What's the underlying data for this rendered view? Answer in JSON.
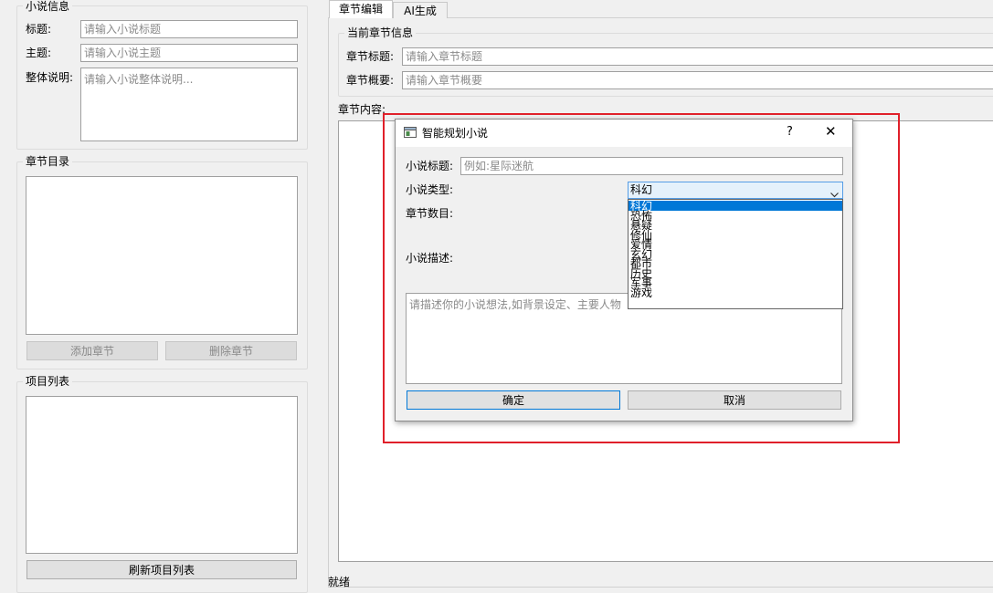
{
  "novel_info": {
    "group_title": "小说信息",
    "title_label": "标题:",
    "title_placeholder": "请输入小说标题",
    "theme_label": "主题:",
    "theme_placeholder": "请输入小说主题",
    "desc_label": "整体说明:",
    "desc_placeholder": "请输入小说整体说明..."
  },
  "chapter_toc": {
    "group_title": "章节目录",
    "add_button": "添加章节",
    "delete_button": "删除章节"
  },
  "project_list": {
    "group_title": "项目列表",
    "refresh_button": "刷新项目列表"
  },
  "tabs": [
    {
      "label": "章节编辑",
      "active": true
    },
    {
      "label": "AI生成",
      "active": false
    }
  ],
  "current_chapter": {
    "group_title": "当前章节信息",
    "title_label": "章节标题:",
    "title_placeholder": "请输入章节标题",
    "summary_label": "章节概要:",
    "summary_placeholder": "请输入章节概要",
    "content_label": "章节内容:"
  },
  "status_text": "就绪",
  "dialog": {
    "title": "智能规划小说",
    "help_glyph": "?",
    "close_glyph": "✕",
    "novel_title_label": "小说标题:",
    "novel_title_placeholder": "例如:星际迷航",
    "novel_type_label": "小说类型:",
    "novel_type_value": "科幻",
    "chapter_count_label": "章节数目:",
    "novel_desc_label": "小说描述:",
    "novel_desc_placeholder": "请描述你的小说想法,如背景设定、主要人物",
    "ok_button": "确定",
    "cancel_button": "取消",
    "type_options": [
      "科幻",
      "恐怖",
      "悬疑",
      "修仙",
      "爱情",
      "玄幻",
      "都市",
      "历史",
      "军事",
      "游戏"
    ],
    "selected_option_index": 0
  },
  "colors": {
    "highlight": "#e0202a",
    "selection": "#0078d7",
    "window_bg": "#f0f0f0"
  }
}
